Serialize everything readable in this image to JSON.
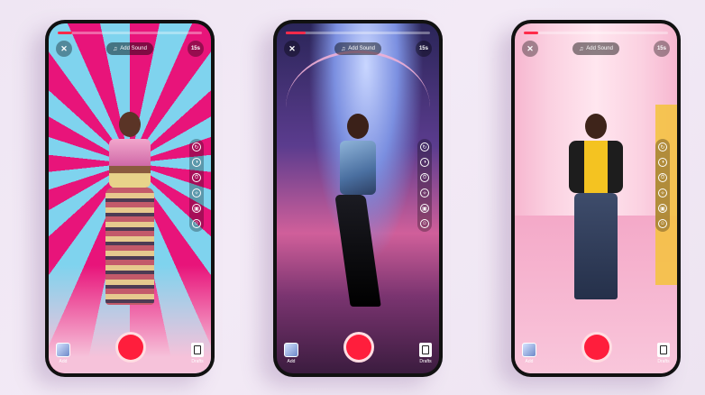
{
  "phones": [
    {
      "progress_percent": 10,
      "close_label": "✕",
      "add_sound_label": "Add Sound",
      "duration_label": "15s",
      "add_label": "Add",
      "drafts_label": "Drafts"
    },
    {
      "progress_percent": 14,
      "close_label": "✕",
      "add_sound_label": "Add Sound",
      "duration_label": "15s",
      "add_label": "Add",
      "drafts_label": "Drafts"
    },
    {
      "progress_percent": 10,
      "close_label": "✕",
      "add_sound_label": "Add Sound",
      "duration_label": "15s",
      "add_label": "Add",
      "drafts_label": "Drafts"
    }
  ],
  "icons": {
    "note": "♫",
    "tools": [
      "↻",
      "◑",
      "⏱",
      "✧",
      "▣",
      "☺"
    ]
  },
  "colors": {
    "record": "#ff1e3c",
    "progress": "#ff2a4a"
  }
}
